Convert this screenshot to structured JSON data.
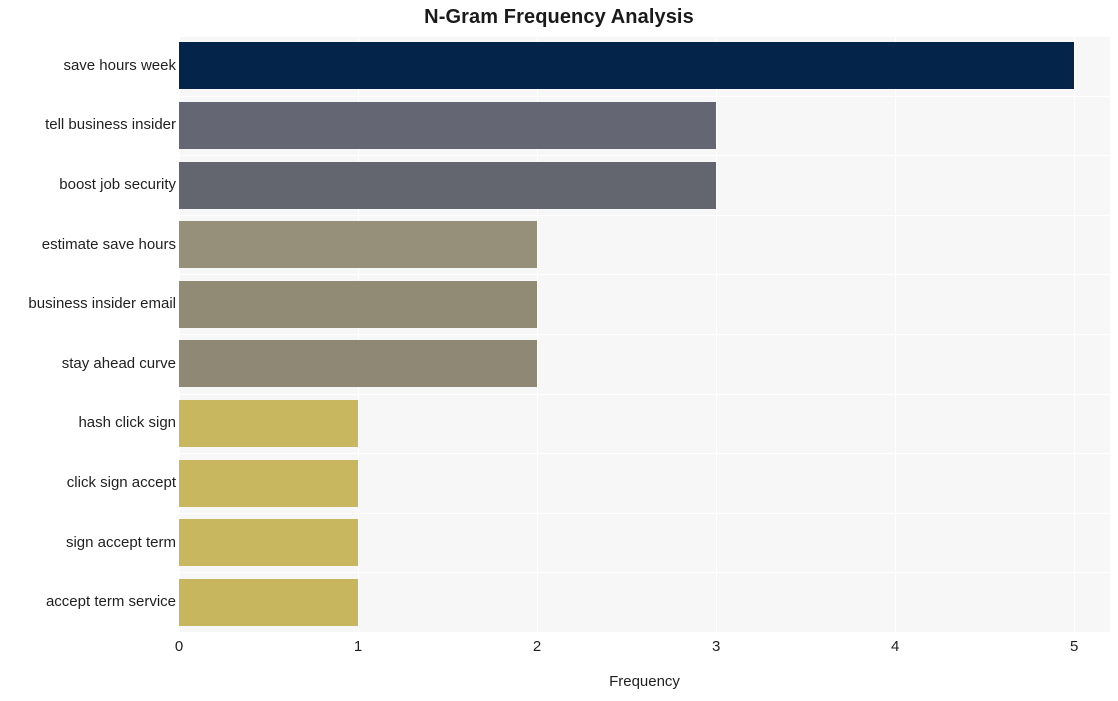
{
  "chart_data": {
    "type": "bar",
    "orientation": "horizontal",
    "title": "N-Gram Frequency Analysis",
    "xlabel": "Frequency",
    "ylabel": "",
    "xlim": [
      0,
      5.2
    ],
    "xticks": [
      "0",
      "1",
      "2",
      "3",
      "4",
      "5"
    ],
    "xtick_values": [
      0,
      1,
      2,
      3,
      4,
      5
    ],
    "grid": true,
    "legend": "none",
    "categories": [
      "save hours week",
      "tell business insider",
      "boost job security",
      "estimate save hours",
      "business insider email",
      "stay ahead curve",
      "hash click sign",
      "click sign accept",
      "sign accept term",
      "accept term service"
    ],
    "values": [
      5,
      3,
      3,
      2,
      2,
      2,
      1,
      1,
      1,
      1
    ],
    "bar_colors": [
      "#052449",
      "#646773",
      "#63666f",
      "#96907a",
      "#918b75",
      "#8e8874",
      "#c8b75f",
      "#c8b75f",
      "#c8b75f",
      "#c7b65e"
    ]
  },
  "style": {
    "plot_background": "#f7f7f7",
    "page_background": "#ffffff",
    "gridline_color": "#ffffff",
    "text_color": "#1f1f1f",
    "title_color": "#1a1a1a"
  }
}
